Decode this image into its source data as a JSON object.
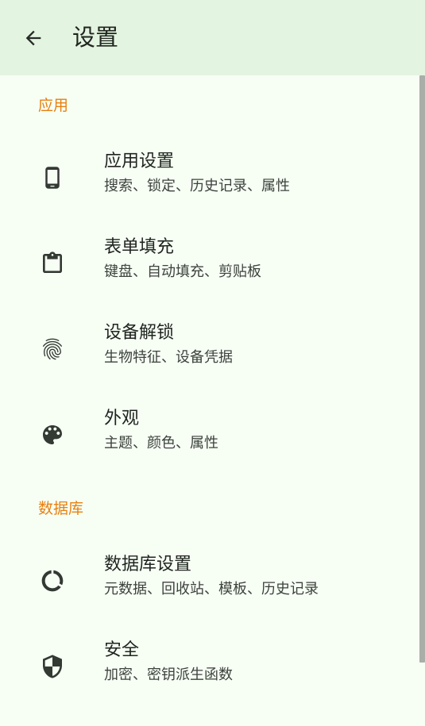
{
  "appbar": {
    "title": "设置",
    "back_icon": "arrow-back-icon"
  },
  "sections": [
    {
      "header": "应用",
      "items": [
        {
          "title": "应用设置",
          "summary": "搜索、锁定、历史记录、属性",
          "icon": "phone-icon"
        },
        {
          "title": "表单填充",
          "summary": "键盘、自动填充、剪贴板",
          "icon": "clipboard-icon"
        },
        {
          "title": "设备解锁",
          "summary": "生物特征、设备凭据",
          "icon": "fingerprint-icon"
        },
        {
          "title": "外观",
          "summary": "主题、颜色、属性",
          "icon": "palette-icon"
        }
      ]
    },
    {
      "header": "数据库",
      "items": [
        {
          "title": "数据库设置",
          "summary": "元数据、回收站、模板、历史记录",
          "icon": "donut-icon"
        },
        {
          "title": "安全",
          "summary": "加密、密钥派生函数",
          "icon": "shield-icon"
        }
      ]
    }
  ],
  "colors": {
    "background": "#f7fff5",
    "appbar": "#e3f4e0",
    "section_header": "#e8800f",
    "icon": "#333a33"
  }
}
